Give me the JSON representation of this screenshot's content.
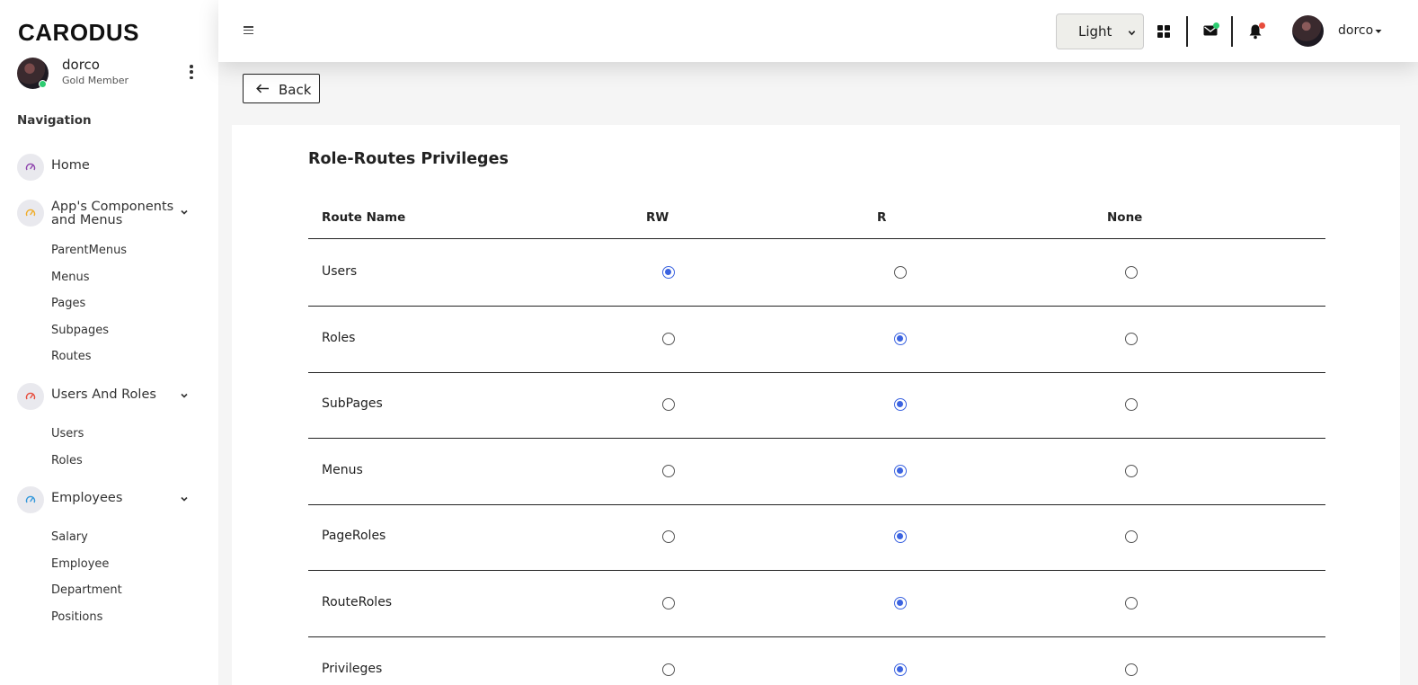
{
  "brand": "CARODUS",
  "profile": {
    "name": "dorco",
    "membership": "Gold Member"
  },
  "sidebar": {
    "nav_title": "Navigation",
    "home": {
      "label": "Home",
      "icon": "gauge-icon",
      "color": "#8e44ad"
    },
    "groups": [
      {
        "label_line1": "App's Components",
        "label_line2": "and Menus",
        "color": "#f0ad2a",
        "items": [
          "ParentMenus",
          "Menus",
          "Pages",
          "Subpages",
          "Routes"
        ]
      },
      {
        "label": "Users And Roles",
        "color": "#e74c3c",
        "items": [
          "Users",
          "Roles"
        ]
      },
      {
        "label": "Employees",
        "color": "#3498db",
        "items": [
          "Salary",
          "Employee",
          "Department",
          "Positions"
        ]
      }
    ]
  },
  "topbar": {
    "theme_value": "Light",
    "mail_dot_color": "#2ecc71",
    "bell_dot_color": "#e74c3c",
    "username": "dorco"
  },
  "back_label": "Back",
  "main": {
    "title": "Role-Routes Privileges",
    "columns": [
      "Route Name",
      "RW",
      "R",
      "None"
    ],
    "rows": [
      {
        "name": "Users",
        "selected": "RW"
      },
      {
        "name": "Roles",
        "selected": "R"
      },
      {
        "name": "SubPages",
        "selected": "R"
      },
      {
        "name": "Menus",
        "selected": "R"
      },
      {
        "name": "PageRoles",
        "selected": "R"
      },
      {
        "name": "RouteRoles",
        "selected": "R"
      },
      {
        "name": "Privileges",
        "selected": "R"
      }
    ]
  },
  "accent_color": "#3b63e0"
}
